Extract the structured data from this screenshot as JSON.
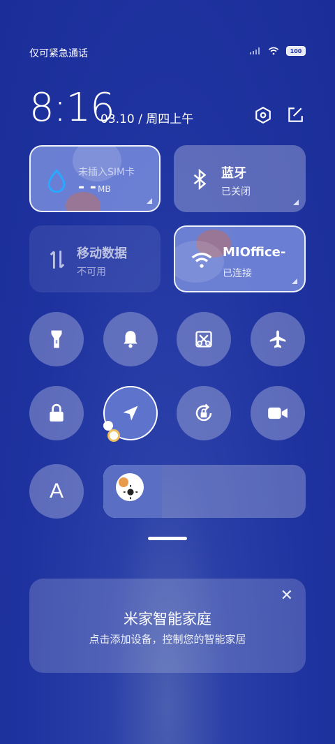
{
  "status": {
    "left_text": "仅可紧急通话",
    "battery": "100"
  },
  "header": {
    "time": "8:16",
    "date": "03.10 / 周四上午"
  },
  "tiles": {
    "sim": {
      "title": "未插入SIM卡",
      "value": "- -",
      "unit": "MB"
    },
    "bluetooth": {
      "title": "蓝牙",
      "sub": "已关闭"
    },
    "mobile_data": {
      "title": "移动数据",
      "sub": "不可用"
    },
    "wifi": {
      "title": "MIOffice-",
      "sub": "已连接"
    }
  },
  "toggles": [
    {
      "name": "flashlight-icon"
    },
    {
      "name": "bell-icon"
    },
    {
      "name": "screenshot-icon"
    },
    {
      "name": "airplane-icon"
    },
    {
      "name": "lock-icon"
    },
    {
      "name": "location-icon"
    },
    {
      "name": "rotation-lock-icon"
    },
    {
      "name": "video-icon"
    }
  ],
  "brightness": {
    "level": 0.29
  },
  "font_button": {
    "label": "A"
  },
  "smart_home": {
    "title": "米家智能家庭",
    "subtitle": "点击添加设备，控制您的智能家居",
    "close": "✕"
  },
  "colors": {
    "accent": "#5e74cc"
  }
}
